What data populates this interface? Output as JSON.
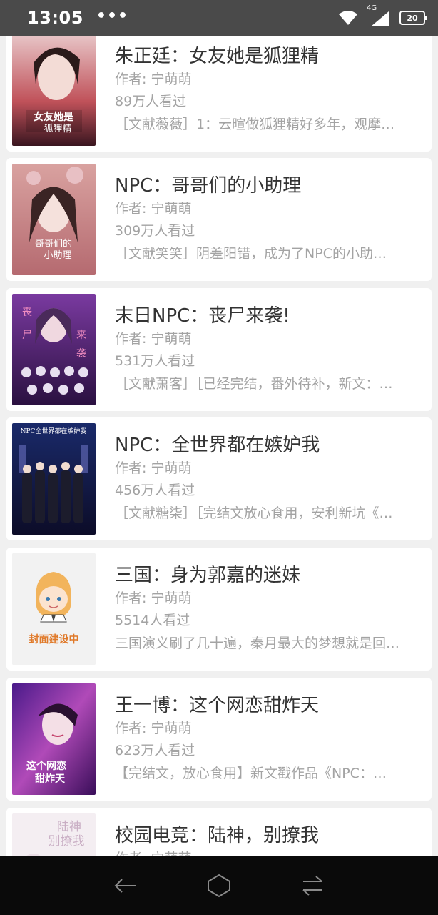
{
  "status": {
    "time": "13:05",
    "more": "•••",
    "network": "4G",
    "battery": "20"
  },
  "colors": {
    "statusbar": "#4a4a4a",
    "navbar": "#0a0a0a",
    "title": "#333333",
    "meta": "#a3a3a3"
  },
  "books": [
    {
      "title": "朱正廷：女友她是狐狸精",
      "author": "作者: 宁萌萌",
      "views": "89万人看过",
      "intro": "［文献薇薇］1：云暄做狐狸精好多年，观摩…",
      "cover_text": "女友她是狐狸精"
    },
    {
      "title": "NPC：哥哥们的小助理",
      "author": "作者: 宁萌萌",
      "views": "309万人看过",
      "intro": "［文献笑笑］阴差阳错，成为了NPC的小助…",
      "cover_text": "哥哥们的小助理"
    },
    {
      "title": "末日NPC：丧尸来袭!",
      "author": "作者: 宁萌萌",
      "views": "531万人看过",
      "intro": "［文献萧客］［已经完结，番外待补，新文：…",
      "cover_text": "丧尸来袭"
    },
    {
      "title": "NPC：全世界都在嫉妒我",
      "author": "作者: 宁萌萌",
      "views": "456万人看过",
      "intro": "［文献糖柒］［完结文放心食用，安利新坑《…",
      "cover_text": "NPC全世界都在嫉妒我"
    },
    {
      "title": "三国：身为郭嘉的迷妹",
      "author": "作者: 宁萌萌",
      "views": "5514人看过",
      "intro": "三国演义刷了几十遍，秦月最大的梦想就是回…",
      "cover_text": "封面建设中"
    },
    {
      "title": "王一博：这个网恋甜炸天",
      "author": "作者: 宁萌萌",
      "views": "623万人看过",
      "intro": "【完结文，放心食用】新文戳作品《NPC：…",
      "cover_text": "这个网恋甜炸天"
    },
    {
      "title": "校园电竞：陆神，别撩我",
      "author": "作者: 宁萌萌",
      "views": "",
      "intro": "",
      "cover_text": "陆神别撩我"
    }
  ],
  "nav": {
    "back": "back-icon",
    "home": "home-icon",
    "recents": "recents-icon"
  }
}
